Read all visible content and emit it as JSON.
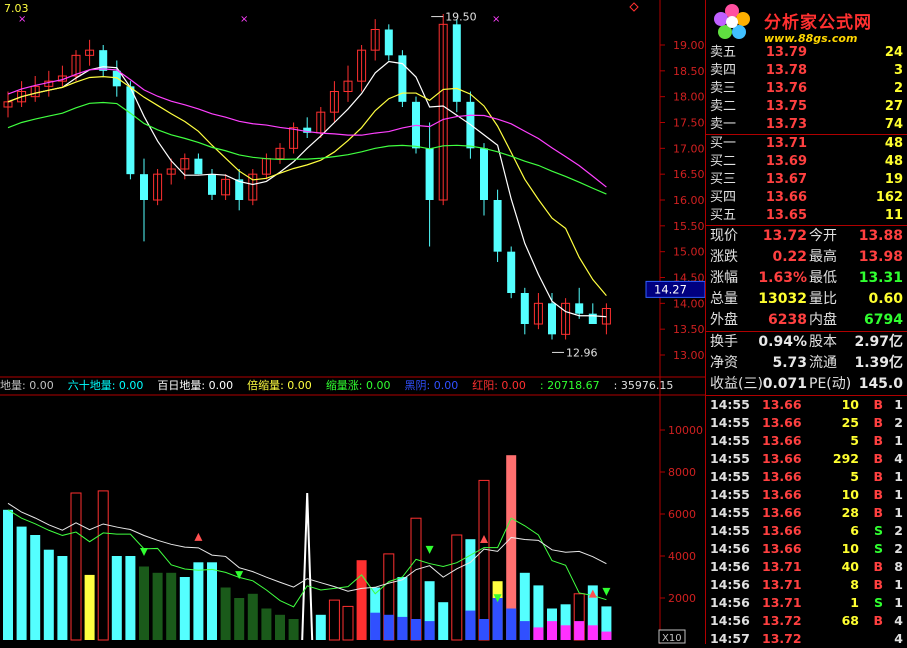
{
  "price_chart": {
    "top_label": "7.03",
    "high_marker": "19.50",
    "low_marker": "12.96",
    "current_price_tag": "14.27",
    "y_ticks": [
      "19.00",
      "18.50",
      "18.00",
      "17.50",
      "17.00",
      "16.50",
      "16.00",
      "15.50",
      "15.00",
      "14.50",
      "14.00",
      "13.50",
      "13.00"
    ],
    "colors": {
      "up": "#ff3030",
      "down": "#54ffff",
      "ma5": "#ffffff",
      "ma10": "#ffff40",
      "ma20": "#ff40ff",
      "ma60": "#40ff40"
    }
  },
  "indicator_bar": {
    "items": [
      {
        "text": "地量: 0.00",
        "color": "#c0c0c0"
      },
      {
        "text": "六十地量: 0.00",
        "color": "#00ffff"
      },
      {
        "text": "百日地量: 0.00",
        "color": "#ffffff"
      },
      {
        "text": "倍缩量: 0.00",
        "color": "#ffff40"
      },
      {
        "text": "缩量涨: 0.00",
        "color": "#30ff30"
      },
      {
        "text": "黑阴: 0.00",
        "color": "#3050ff"
      },
      {
        "text": "红阳: 0.00",
        "color": "#ff3030"
      },
      {
        "text": ": 20718.67",
        "color": "#30ff30"
      },
      {
        "text": ": 35976.15",
        "color": "#e0e0e0"
      }
    ]
  },
  "volume_chart": {
    "y_ticks": [
      "10000",
      "8000",
      "6000",
      "4000",
      "2000"
    ],
    "x_label": "X10"
  },
  "logo": {
    "title": "分析家公式网",
    "url": "www.88gs.com"
  },
  "asks": [
    {
      "label": "卖五",
      "price": "13.79",
      "vol": "24"
    },
    {
      "label": "卖四",
      "price": "13.78",
      "vol": "3"
    },
    {
      "label": "卖三",
      "price": "13.76",
      "vol": "2"
    },
    {
      "label": "卖二",
      "price": "13.75",
      "vol": "27"
    },
    {
      "label": "卖一",
      "price": "13.73",
      "vol": "74"
    }
  ],
  "bids": [
    {
      "label": "买一",
      "price": "13.71",
      "vol": "48"
    },
    {
      "label": "买二",
      "price": "13.69",
      "vol": "48"
    },
    {
      "label": "买三",
      "price": "13.67",
      "vol": "19"
    },
    {
      "label": "买四",
      "price": "13.66",
      "vol": "162"
    },
    {
      "label": "买五",
      "price": "13.65",
      "vol": "11"
    }
  ],
  "stats": [
    {
      "l1": "现价",
      "v1": "13.72",
      "c1": "red",
      "l2": "今开",
      "v2": "13.88",
      "c2": "red"
    },
    {
      "l1": "涨跌",
      "v1": "0.22",
      "c1": "red",
      "l2": "最高",
      "v2": "13.98",
      "c2": "red"
    },
    {
      "l1": "涨幅",
      "v1": "1.63%",
      "c1": "red",
      "l2": "最低",
      "v2": "13.31",
      "c2": "green"
    },
    {
      "l1": "总量",
      "v1": "13032",
      "c1": "yellow",
      "l2": "量比",
      "v2": "0.60",
      "c2": "yellow"
    },
    {
      "l1": "外盘",
      "v1": "6238",
      "c1": "red",
      "l2": "内盘",
      "v2": "6794",
      "c2": "green"
    }
  ],
  "fundamentals": [
    {
      "l1": "换手",
      "v1": "0.94%",
      "l2": "股本",
      "v2": "2.97亿"
    },
    {
      "l1": "净资",
      "v1": "5.73",
      "l2": "流通",
      "v2": "1.39亿"
    },
    {
      "l1": "收益(三)",
      "v1": "0.071",
      "l2": "PE(动)",
      "v2": "145.0"
    }
  ],
  "ticks": [
    {
      "time": "14:55",
      "price": "13.66",
      "vol": "10",
      "side": "B",
      "num": "1"
    },
    {
      "time": "14:55",
      "price": "13.66",
      "vol": "25",
      "side": "B",
      "num": "2"
    },
    {
      "time": "14:55",
      "price": "13.66",
      "vol": "5",
      "side": "B",
      "num": "1"
    },
    {
      "time": "14:55",
      "price": "13.66",
      "vol": "292",
      "side": "B",
      "num": "4"
    },
    {
      "time": "14:55",
      "price": "13.66",
      "vol": "5",
      "side": "B",
      "num": "1"
    },
    {
      "time": "14:55",
      "price": "13.66",
      "vol": "10",
      "side": "B",
      "num": "1"
    },
    {
      "time": "14:55",
      "price": "13.66",
      "vol": "28",
      "side": "B",
      "num": "1"
    },
    {
      "time": "14:55",
      "price": "13.66",
      "vol": "6",
      "side": "S",
      "num": "2"
    },
    {
      "time": "14:56",
      "price": "13.66",
      "vol": "10",
      "side": "S",
      "num": "2"
    },
    {
      "time": "14:56",
      "price": "13.71",
      "vol": "40",
      "side": "B",
      "num": "8"
    },
    {
      "time": "14:56",
      "price": "13.71",
      "vol": "8",
      "side": "B",
      "num": "1"
    },
    {
      "time": "14:56",
      "price": "13.71",
      "vol": "1",
      "side": "S",
      "num": "1"
    },
    {
      "time": "14:56",
      "price": "13.72",
      "vol": "68",
      "side": "B",
      "num": "4"
    },
    {
      "time": "14:57",
      "price": "13.72",
      "vol": "",
      "side": "",
      "num": "4"
    }
  ]
}
